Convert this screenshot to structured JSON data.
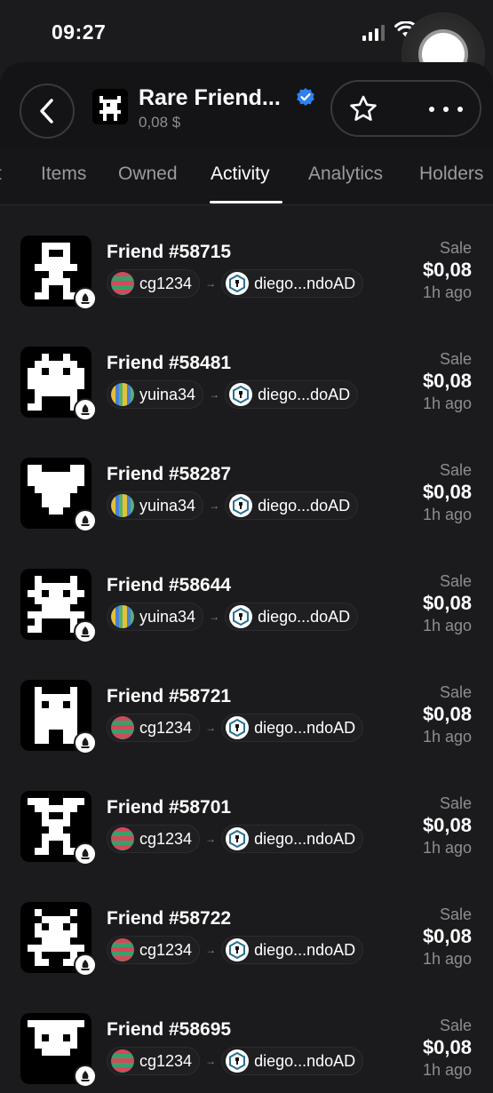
{
  "status_bar": {
    "time": "09:27"
  },
  "header": {
    "title": "Rare Friend...",
    "floor_price": "0,08 $"
  },
  "tabs": [
    {
      "label": "Items"
    },
    {
      "label": "Owned"
    },
    {
      "label": "Activity",
      "active": true
    },
    {
      "label": "Analytics"
    },
    {
      "label": "Holders"
    }
  ],
  "activity": [
    {
      "name": "Friend #58715",
      "from": "cg1234",
      "from_avatar": "cg",
      "to": "diego...ndoAD",
      "type": "Sale",
      "amount": "$0,08",
      "time": "1h ago"
    },
    {
      "name": "Friend #58481",
      "from": "yuina34",
      "from_avatar": "yu",
      "to": "diego...doAD",
      "type": "Sale",
      "amount": "$0,08",
      "time": "1h ago"
    },
    {
      "name": "Friend #58287",
      "from": "yuina34",
      "from_avatar": "yu",
      "to": "diego...doAD",
      "type": "Sale",
      "amount": "$0,08",
      "time": "1h ago"
    },
    {
      "name": "Friend #58644",
      "from": "yuina34",
      "from_avatar": "yu",
      "to": "diego...doAD",
      "type": "Sale",
      "amount": "$0,08",
      "time": "1h ago"
    },
    {
      "name": "Friend #58721",
      "from": "cg1234",
      "from_avatar": "cg",
      "to": "diego...ndoAD",
      "type": "Sale",
      "amount": "$0,08",
      "time": "1h ago"
    },
    {
      "name": "Friend #58701",
      "from": "cg1234",
      "from_avatar": "cg",
      "to": "diego...ndoAD",
      "type": "Sale",
      "amount": "$0,08",
      "time": "1h ago"
    },
    {
      "name": "Friend #58722",
      "from": "cg1234",
      "from_avatar": "cg",
      "to": "diego...ndoAD",
      "type": "Sale",
      "amount": "$0,08",
      "time": "1h ago"
    },
    {
      "name": "Friend #58695",
      "from": "cg1234",
      "from_avatar": "cg",
      "to": "diego...ndoAD",
      "type": "Sale",
      "amount": "$0,08",
      "time": "1h ago"
    }
  ],
  "colors": {
    "background": "#1b1b1d",
    "verified": "#2f80ed",
    "muted_text": "#8d8d92"
  },
  "icons": [
    "back-chevron-icon",
    "verified-badge-icon",
    "star-icon",
    "more-icon",
    "chain-badge-icon",
    "arrow-right-icon"
  ]
}
